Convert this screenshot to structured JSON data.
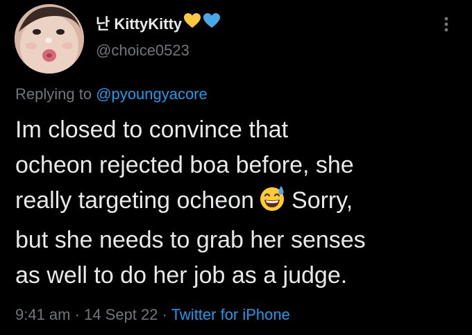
{
  "user": {
    "display_name": "난 KittyKitty",
    "handle": "@choice0523",
    "avatar": "profile-photo"
  },
  "reply": {
    "prefix": "Replying to",
    "mention": "@pyoungyacore"
  },
  "tweet": {
    "lines": [
      "Im closed to convince that",
      "ocheon rejected boa before, she",
      "really targeting ocheon",
      "Sorry,",
      "but she needs to grab her senses",
      "as well to do her job as a judge."
    ],
    "emoji": "grinning-sweat-emoji"
  },
  "meta": {
    "time": "9:41 am",
    "separator": "·",
    "date": "14 Sept 22",
    "source": "Twitter for iPhone"
  },
  "icons": {
    "more": "more-vertical-icon",
    "heart_yellow": "yellow-heart-icon",
    "heart_blue": "blue-heart-icon"
  },
  "colors": {
    "background": "#000000",
    "text": "#e7e9ea",
    "secondary": "#71767b",
    "link": "#1d9bf0",
    "yellow_heart": "#ffc83d",
    "blue_heart": "#4aa8e8"
  }
}
